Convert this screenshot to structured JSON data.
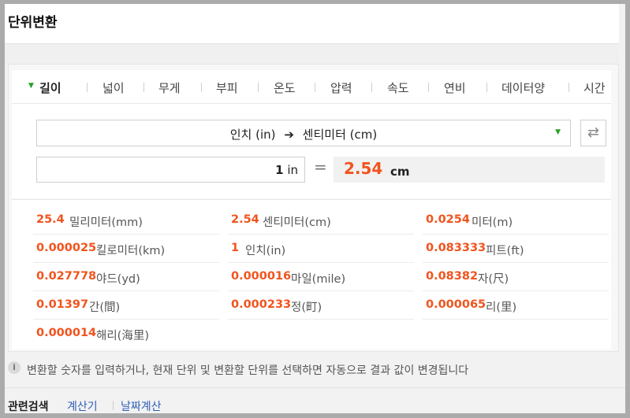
{
  "title": "단위변환",
  "tabs": [
    "길이",
    "넓이",
    "무게",
    "부피",
    "온도",
    "압력",
    "속도",
    "연비",
    "데이터양",
    "시간"
  ],
  "active_tab": "길이",
  "selector": {
    "from_label": "인치",
    "from_code": "(in)",
    "arrow": "➔",
    "to_label": "센티미터",
    "to_code": "(cm)"
  },
  "input": {
    "value": "1",
    "unit": "in"
  },
  "equals": "=",
  "result": {
    "value": "2.54",
    "unit": "cm"
  },
  "conversions": [
    {
      "value": "25.4",
      "name": "밀리미터(mm)"
    },
    {
      "value": "2.54",
      "name": "센티미터(cm)"
    },
    {
      "value": "0.0254",
      "name": "미터(m)"
    },
    {
      "value": "0.000025",
      "name": "킬로미터(km)"
    },
    {
      "value": "1",
      "name": "인치(in)"
    },
    {
      "value": "0.083333",
      "name": "피트(ft)"
    },
    {
      "value": "0.027778",
      "name": "야드(yd)"
    },
    {
      "value": "0.000016",
      "name": "마일(mile)"
    },
    {
      "value": "0.08382",
      "name": "자(尺)"
    },
    {
      "value": "0.01397",
      "name": "간(間)"
    },
    {
      "value": "0.000233",
      "name": "정(町)"
    },
    {
      "value": "0.000065",
      "name": "리(里)"
    },
    {
      "value": "0.000014",
      "name": "해리(海里)"
    }
  ],
  "notice": "변환할 숫자를 입력하거나, 현재 단위 및 변환할 단위를 선택하면 자동으로 결과 값이 변경됩니다",
  "notice_icon": "i",
  "related": {
    "label": "관련검색",
    "links": [
      "계산기",
      "날짜계산"
    ]
  },
  "colors": {
    "accent": "#f0541e",
    "link": "#2f5fb6",
    "caret": "#26a126"
  }
}
